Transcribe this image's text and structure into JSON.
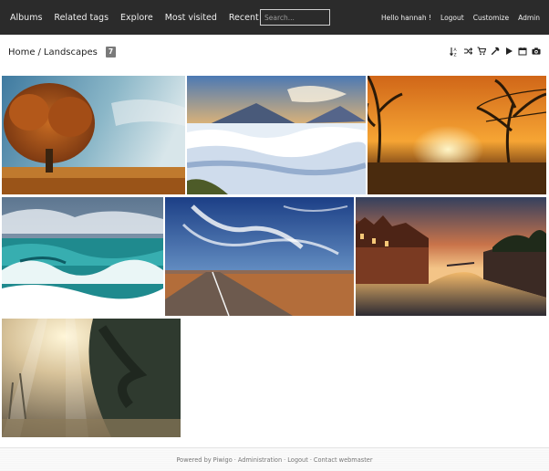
{
  "nav": {
    "albums": "Albums",
    "related_tags": "Related tags",
    "explore": "Explore",
    "most_visited": "Most visited",
    "recent_photos": "Recent photos",
    "search_placeholder": "Search...",
    "greeting": "Hello hannah !",
    "logout": "Logout",
    "customize": "Customize",
    "admin": "Admin"
  },
  "breadcrumb": {
    "home": "Home",
    "separator": "/",
    "current": "Landscapes",
    "count": "7"
  },
  "toolbar_icons": [
    "sort-icon",
    "random-icon",
    "cart-icon",
    "edit-icon",
    "slideshow-icon",
    "calendar-icon",
    "camera-icon"
  ],
  "photos": [
    {
      "name": "autumn-tree"
    },
    {
      "name": "volcano-clouds"
    },
    {
      "name": "sunset-trees"
    },
    {
      "name": "ocean-waves"
    },
    {
      "name": "desert-road"
    },
    {
      "name": "canal-city"
    },
    {
      "name": "misty-forest"
    }
  ],
  "footer": {
    "powered_by": "Powered by",
    "piwigo": "Piwigo",
    "sep": "·",
    "administration": "Administration",
    "logout": "Logout",
    "contact": "Contact webmaster"
  }
}
